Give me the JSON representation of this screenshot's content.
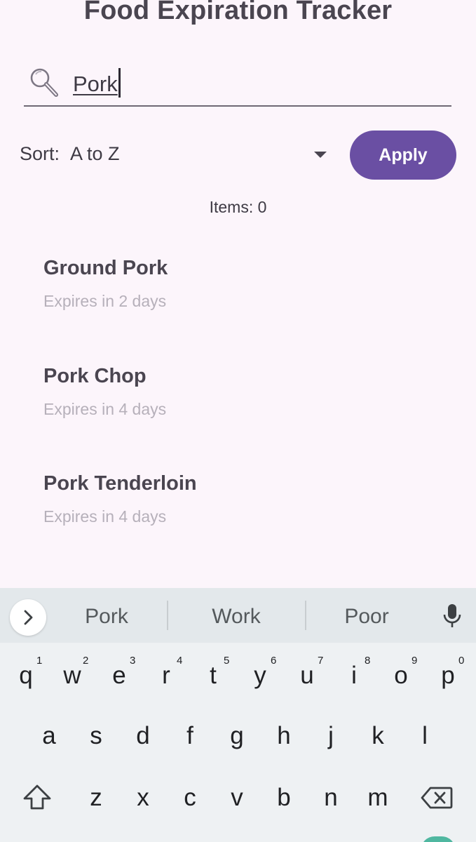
{
  "app": {
    "title": "Food Expiration Tracker"
  },
  "search": {
    "value": "Pork",
    "icon": "search-icon"
  },
  "sort": {
    "label": "Sort:",
    "value": "A to Z"
  },
  "apply": {
    "label": "Apply"
  },
  "items_count": "Items: 0",
  "foods": [
    {
      "name": "Ground Pork",
      "expiry": "Expires in 2 days"
    },
    {
      "name": "Pork Chop",
      "expiry": "Expires in 4 days"
    },
    {
      "name": "Pork Tenderloin",
      "expiry": "Expires in 4 days"
    }
  ],
  "keyboard": {
    "suggestions": [
      "Pork",
      "Work",
      "Poor"
    ],
    "row1": [
      "q",
      "w",
      "e",
      "r",
      "t",
      "y",
      "u",
      "i",
      "o",
      "p"
    ],
    "row1_hints": [
      "1",
      "2",
      "3",
      "4",
      "5",
      "6",
      "7",
      "8",
      "9",
      "0"
    ],
    "row2": [
      "a",
      "s",
      "d",
      "f",
      "g",
      "h",
      "j",
      "k",
      "l"
    ],
    "row3": [
      "z",
      "x",
      "c",
      "v",
      "b",
      "n",
      "m"
    ]
  },
  "colors": {
    "accent": "#6a4fa3",
    "background": "#fcf5fb"
  }
}
